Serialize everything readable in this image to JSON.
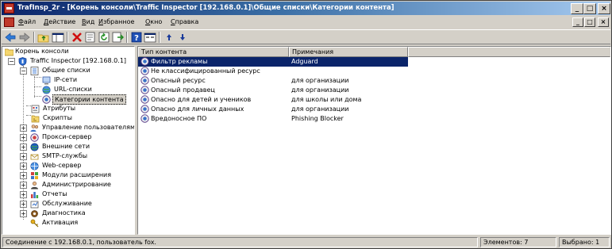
{
  "window": {
    "title": "TrafInsp_2r - [Корень консоли\\Traffic Inspector [192.168.0.1]\\Общие списки\\Категории контента]",
    "controls": {
      "minimize": "_",
      "maximize": "□",
      "close": "×"
    }
  },
  "menu": {
    "items": [
      "Файл",
      "Действие",
      "Вид",
      "Избранное",
      "Окно",
      "Справка"
    ],
    "mdi_controls": {
      "minimize": "_",
      "restore": "□",
      "close": "×"
    }
  },
  "toolbar": {
    "icons": [
      "back-icon",
      "forward-icon",
      "up-folder-icon",
      "show-hide-tree-icon",
      "delete-icon",
      "properties-icon",
      "refresh-icon",
      "export-icon",
      "help-icon",
      "view-icon",
      "move-up-icon",
      "move-down-icon"
    ]
  },
  "tree": {
    "root": "Корень консоли",
    "server": "Traffic Inspector [192.168.0.1]",
    "common_lists": "Общие списки",
    "common_children": [
      "IP-сети",
      "URL-списки",
      "Категории контента"
    ],
    "attributes": "Атрибуты",
    "scripts": "Скрипты",
    "sections": [
      "Управление пользователями",
      "Прокси-сервер",
      "Внешние сети",
      "SMTP-службы",
      "Web-сервер",
      "Модули расширения",
      "Администрирование",
      "Отчеты",
      "Обслуживание",
      "Диагностика"
    ],
    "activation": "Активация"
  },
  "list": {
    "columns": [
      "Тип контента",
      "Примечания"
    ],
    "rows": [
      {
        "type": "Фильтр рекламы",
        "note": "Adguard",
        "selected": true
      },
      {
        "type": "Не классифицированный ресурс",
        "note": ""
      },
      {
        "type": "Опасный ресурс",
        "note": "для организации"
      },
      {
        "type": "Опасный продавец",
        "note": "для организации"
      },
      {
        "type": "Опасно для детей и учеников",
        "note": "для школы или дома"
      },
      {
        "type": "Опасно для личных данных",
        "note": "для организации"
      },
      {
        "type": "Вредоносное ПО",
        "note": "Phishing Blocker"
      }
    ]
  },
  "status": {
    "connection": "Соединение с 192.168.0.1, пользователь fox.",
    "items_count": "Элементов: 7",
    "selected_count": "Выбрано: 1"
  },
  "colors": {
    "title_bar": "#0a246a",
    "selection": "#0a246a",
    "face": "#d4d0c8"
  }
}
